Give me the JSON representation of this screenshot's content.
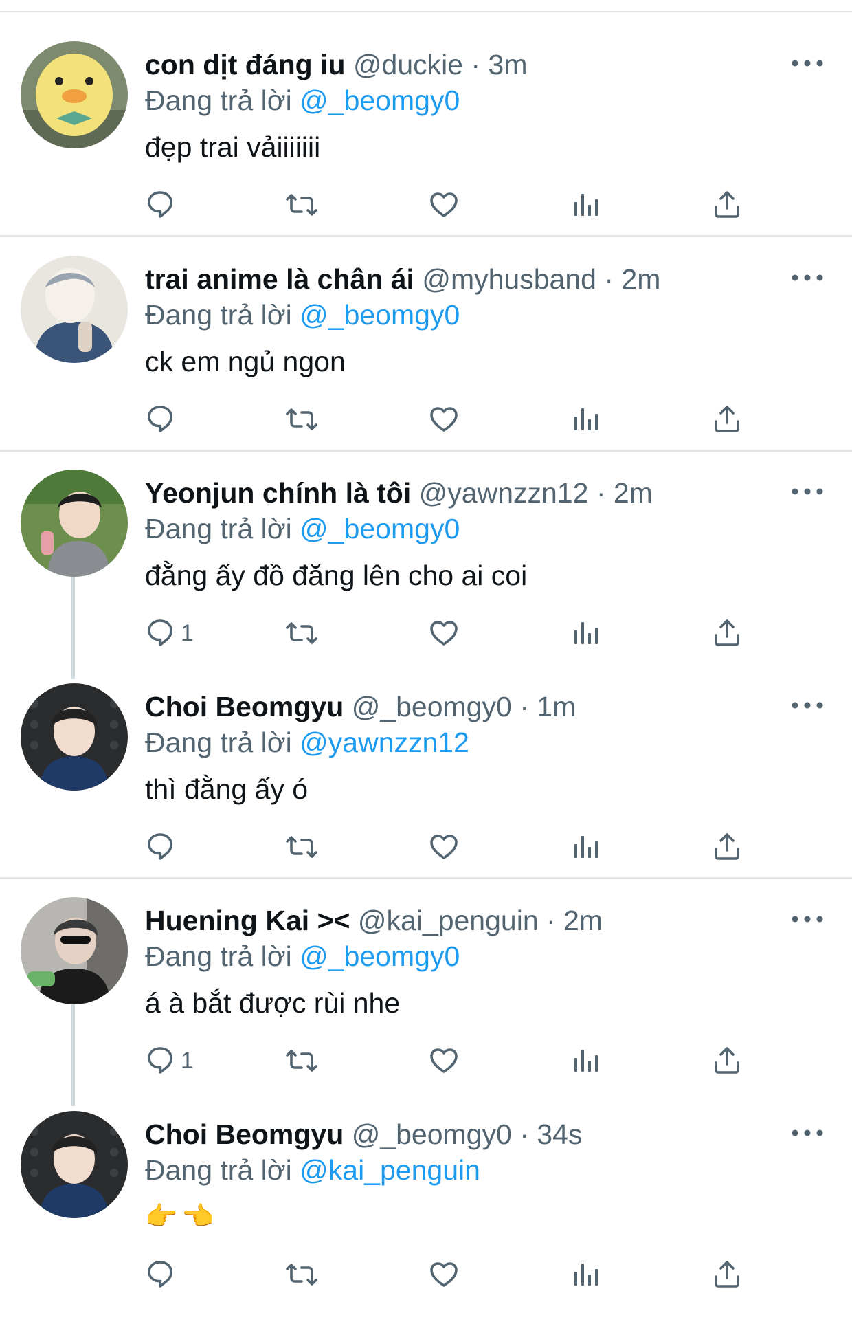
{
  "reply_prefix": "Đang trả lời",
  "colors": {
    "name": "#0f1419",
    "secondary": "#536471",
    "mention": "#1d9bf0",
    "divider": "#e3e5e7"
  },
  "icons": [
    "more-icon",
    "reply-icon",
    "retweet-icon",
    "like-icon",
    "views-icon",
    "share-icon"
  ],
  "tweets": [
    {
      "name": "con dịt đáng iu",
      "handle": "@duckie",
      "sep": "·",
      "time": "3m",
      "reply_to": "@_beomgy0",
      "text": "đẹp trai vảiiiiiii",
      "reply_count": ""
    },
    {
      "name": "trai anime là chân ái",
      "handle": "@myhusband",
      "sep": "·",
      "time": "2m",
      "reply_to": "@_beomgy0",
      "text": "ck em ngủ ngon",
      "reply_count": ""
    },
    {
      "name": "Yeonjun chính là tôi",
      "handle": "@yawnzzn12",
      "sep": "·",
      "time": "2m",
      "reply_to": "@_beomgy0",
      "text": "đằng ấy đồ đăng lên cho ai coi",
      "reply_count": "1"
    },
    {
      "name": "Choi Beomgyu",
      "handle": "@_beomgy0",
      "sep": "·",
      "time": "1m",
      "reply_to": "@yawnzzn12",
      "text": "thì đằng ấy ó",
      "reply_count": ""
    },
    {
      "name": "Huening Kai ><",
      "handle": "@kai_penguin",
      "sep": "·",
      "time": "2m",
      "reply_to": "@_beomgy0",
      "text": "á à bắt được rùi nhe",
      "reply_count": "1"
    },
    {
      "name": "Choi Beomgyu",
      "handle": "@_beomgy0",
      "sep": "·",
      "time": "34s",
      "reply_to": "@kai_penguin",
      "text": "👉👈",
      "reply_count": ""
    }
  ]
}
